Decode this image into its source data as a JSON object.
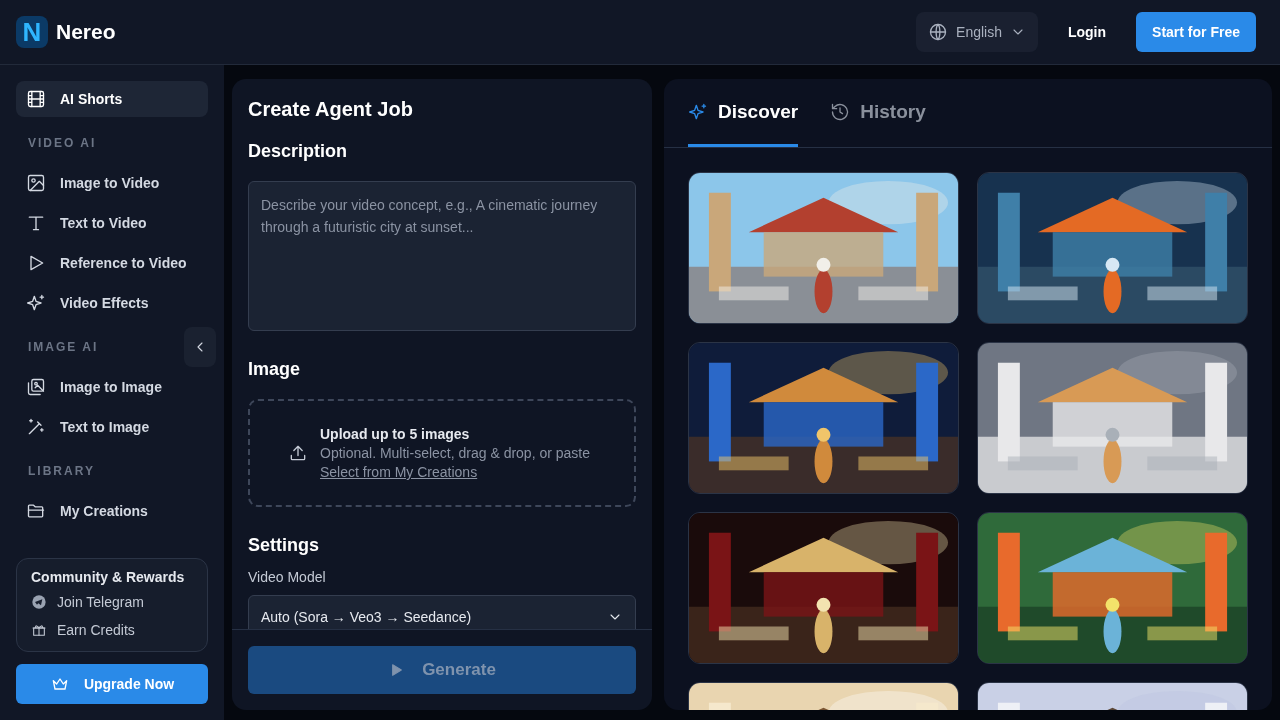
{
  "brand": {
    "name": "Nereo",
    "logo_letter": "N"
  },
  "header": {
    "language": "English",
    "login": "Login",
    "cta": "Start for Free"
  },
  "sidebar": {
    "top": {
      "label": "AI Shorts",
      "selected": true
    },
    "sections": [
      {
        "title": "VIDEO AI",
        "items": [
          {
            "label": "Image to Video",
            "selected": false
          },
          {
            "label": "Text to Video",
            "selected": false
          },
          {
            "label": "Reference to Video",
            "selected": false
          },
          {
            "label": "Video Effects",
            "selected": false
          }
        ]
      },
      {
        "title": "IMAGE AI",
        "items": [
          {
            "label": "Image to Image",
            "selected": false
          },
          {
            "label": "Text to Image",
            "selected": false
          }
        ]
      },
      {
        "title": "LIBRARY",
        "items": [
          {
            "label": "My Creations",
            "selected": false
          }
        ]
      }
    ],
    "community": {
      "title": "Community & Rewards",
      "links": [
        "Join Telegram",
        "Earn Credits"
      ]
    },
    "upgrade": "Upgrade Now"
  },
  "job": {
    "title": "Create Agent Job",
    "description_heading": "Description",
    "description_placeholder": "Describe your video concept, e.g., A cinematic journey through a futuristic city at sunset...",
    "image_heading": "Image",
    "upload_title": "Upload up to 5 images",
    "upload_hint": "Optional. Multi-select, drag & drop, or paste",
    "upload_link": "Select from My Creations",
    "settings_heading": "Settings",
    "model_label": "Video Model",
    "model_value": "Auto (Sora → Veo3 → Seedance)",
    "generate": {
      "label": "Generate",
      "disabled": true
    }
  },
  "tabs": [
    {
      "label": "Discover",
      "selected": true
    },
    {
      "label": "History",
      "selected": false
    }
  ]
}
